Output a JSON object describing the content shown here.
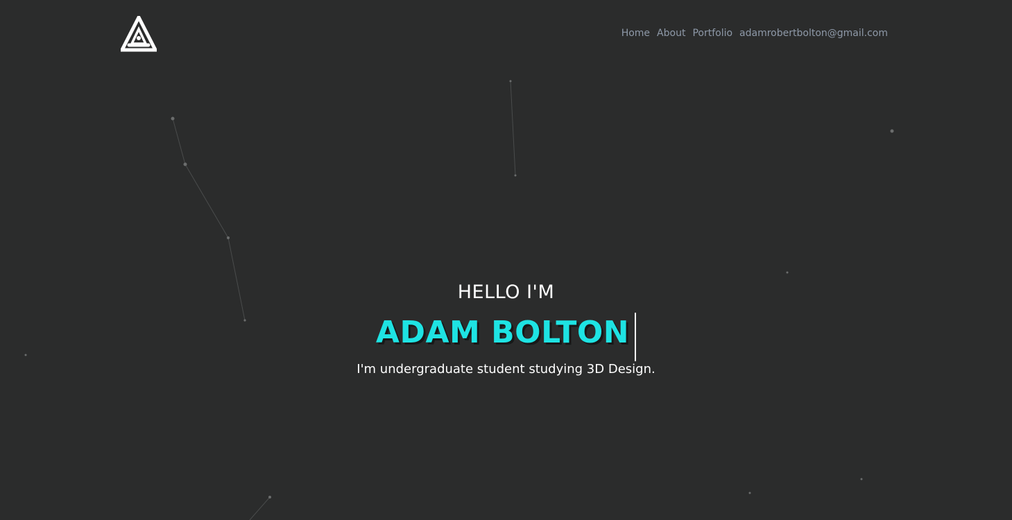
{
  "nav": {
    "items": [
      {
        "label": "Home"
      },
      {
        "label": "About"
      },
      {
        "label": "Portfolio"
      },
      {
        "label": "adamrobertbolton@gmail.com"
      }
    ]
  },
  "hero": {
    "greeting": "HELLO I'M",
    "name": "ADAM BOLTON",
    "tagline": "I'm undergraduate student studying 3D Design."
  },
  "colors": {
    "background": "#2b2c2c",
    "accent": "#1ee3e3",
    "nav_text": "#8e99a8",
    "particle": "#6b6d6d"
  },
  "icons": {
    "logo": "triangle-a-logo-icon"
  }
}
